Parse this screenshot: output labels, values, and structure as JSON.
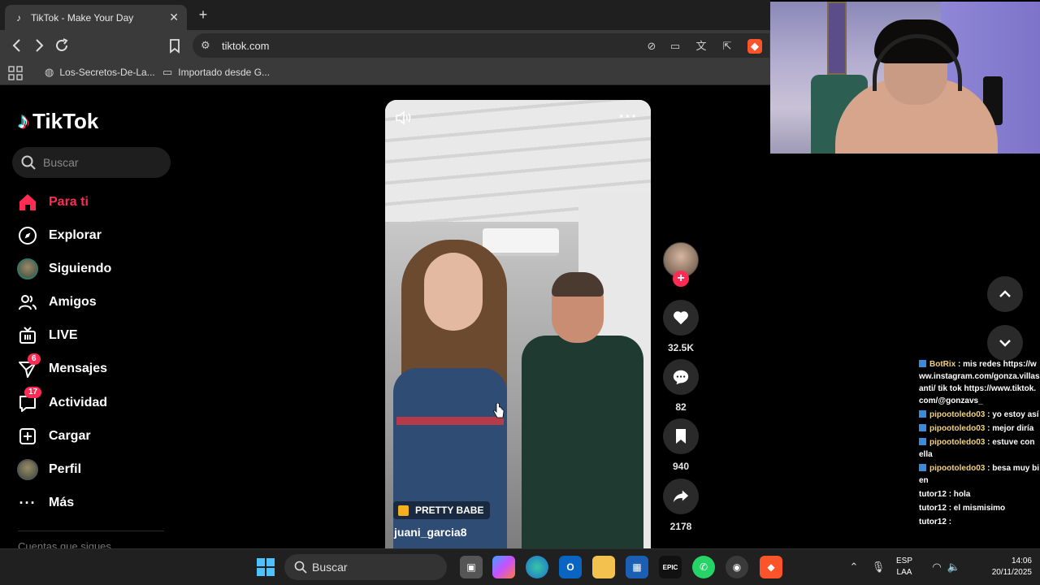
{
  "browser": {
    "tab_title": "TikTok - Make Your Day",
    "tab_close": "✕",
    "new_tab": "+",
    "url": "tiktok.com",
    "bookmarks": [
      {
        "label": "Los-Secretos-De-La..."
      },
      {
        "label": "Importado desde G..."
      }
    ]
  },
  "tiktok": {
    "logo_text": "TikTok",
    "search_placeholder": "Buscar",
    "menu": [
      {
        "label": "Para ti",
        "icon": "home-icon",
        "active": true
      },
      {
        "label": "Explorar",
        "icon": "compass-icon"
      },
      {
        "label": "Siguiendo",
        "icon": "following-avatar"
      },
      {
        "label": "Amigos",
        "icon": "friends-icon"
      },
      {
        "label": "LIVE",
        "icon": "live-icon"
      },
      {
        "label": "Mensajes",
        "icon": "messages-icon",
        "badge": "6"
      },
      {
        "label": "Actividad",
        "icon": "activity-icon",
        "badge": "17"
      },
      {
        "label": "Cargar",
        "icon": "upload-icon"
      },
      {
        "label": "Perfil",
        "icon": "profile-avatar"
      },
      {
        "label": "Más",
        "icon": "more-icon"
      }
    ],
    "following_hint": "Cuentas que sigues"
  },
  "video": {
    "tag": "PRETTY BABE",
    "author": "juani_garcia8",
    "likes": "32.5K",
    "comments": "82",
    "saves": "940",
    "shares": "2178"
  },
  "chat": [
    {
      "user": "BotRix",
      "text": ": mis redes https://www.instagram.com/gonza.villasanti/ tik tok https://www.tiktok.com/@gonzavs_",
      "badge": true
    },
    {
      "user": "pipootoledo03",
      "text": ": yo estoy así",
      "badge": true
    },
    {
      "user": "pipootoledo03",
      "text": ": mejor diría",
      "badge": true
    },
    {
      "user": "pipootoledo03",
      "text": ": estuve con ella",
      "badge": true
    },
    {
      "user": "pipootoledo03",
      "text": ": besa muy bien",
      "badge": true
    },
    {
      "user": "tutor12",
      "text": ": hola",
      "badge": false
    },
    {
      "user": "tutor12",
      "text": ": el mismisimo",
      "badge": false
    },
    {
      "user": "tutor12",
      "text": ":",
      "badge": false
    }
  ],
  "taskbar": {
    "search_label": "Buscar",
    "lang_line1": "ESP",
    "lang_line2": "LAA",
    "time": "14:06",
    "date": "20/11/2025"
  },
  "colors": {
    "accent": "#fe2c55",
    "chat_user": "#f3d27a"
  }
}
